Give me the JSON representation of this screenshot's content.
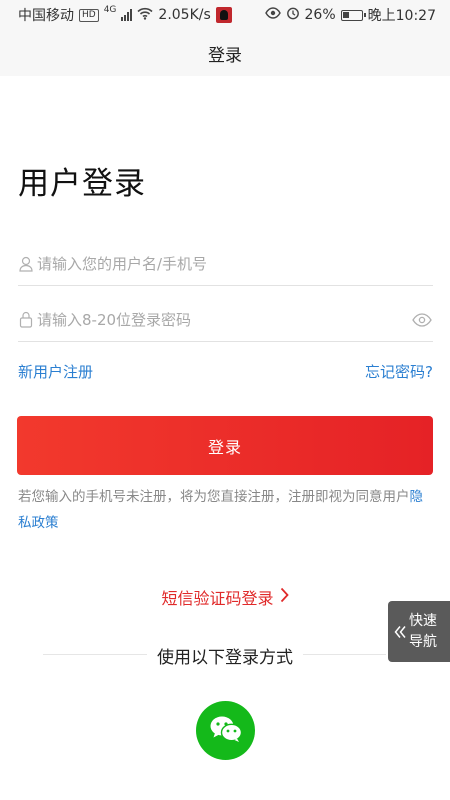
{
  "status_bar": {
    "carrier": "中国移动",
    "hd_badge": "HD",
    "network": "4G",
    "speed": "2.05K/s",
    "battery": "26%",
    "time": "晚上10:27",
    "icons": [
      "signal-icon",
      "wifi-icon",
      "app-notification-icon",
      "eye-icon",
      "alarm-icon",
      "battery-icon"
    ]
  },
  "header": {
    "title": "登录"
  },
  "form": {
    "heading": "用户登录",
    "username_placeholder": "请输入您的用户名/手机号",
    "password_placeholder": "请输入8-20位登录密码",
    "register_link": "新用户注册",
    "forgot_link": "忘记密码?",
    "login_button": "登录"
  },
  "notice": {
    "text": "若您输入的手机号未注册，将为您直接注册，注册即视为同意用户",
    "privacy_link": "隐私政策"
  },
  "sms_login": {
    "label": "短信验证码登录"
  },
  "other_login": {
    "title": "使用以下登录方式",
    "methods": [
      "wechat-icon"
    ]
  },
  "quick_nav": {
    "line1": "快速",
    "line2": "导航"
  },
  "colors": {
    "accent_red": "#e52226",
    "link_blue": "#2b7fd1",
    "wechat_green": "#14b91a",
    "quicknav_bg": "#5a5a5a"
  }
}
